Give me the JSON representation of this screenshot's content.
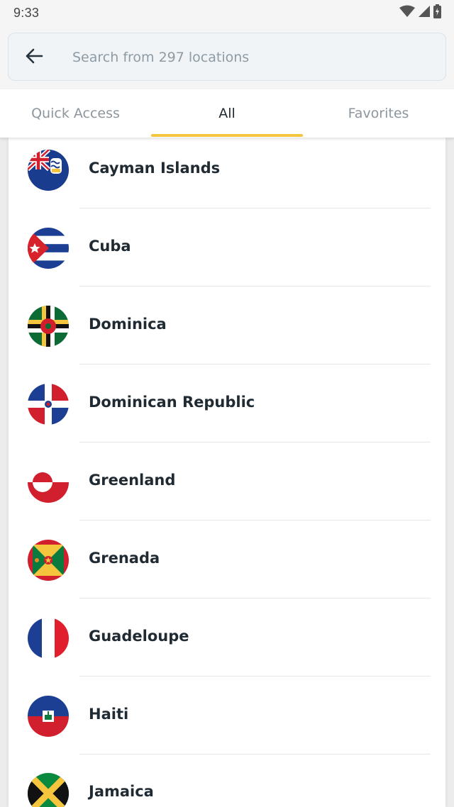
{
  "status_bar": {
    "time": "9:33",
    "icons": [
      "wifi-icon",
      "signal-icon",
      "battery-icon"
    ]
  },
  "search": {
    "back_icon": "arrow-left-icon",
    "placeholder": "Search from 297 locations",
    "value": ""
  },
  "tabs": [
    {
      "label": "Quick Access",
      "active": false
    },
    {
      "label": "All",
      "active": true
    },
    {
      "label": "Favorites",
      "active": false
    }
  ],
  "colors": {
    "accent": "#f4c53d",
    "text_primary": "#1f2a33",
    "text_muted": "#8c969e"
  },
  "locations": [
    {
      "name": "Cayman Islands",
      "flag": "cayman-islands-flag-icon"
    },
    {
      "name": "Cuba",
      "flag": "cuba-flag-icon"
    },
    {
      "name": "Dominica",
      "flag": "dominica-flag-icon"
    },
    {
      "name": "Dominican Republic",
      "flag": "dominican-republic-flag-icon"
    },
    {
      "name": "Greenland",
      "flag": "greenland-flag-icon"
    },
    {
      "name": "Grenada",
      "flag": "grenada-flag-icon"
    },
    {
      "name": "Guadeloupe",
      "flag": "guadeloupe-flag-icon"
    },
    {
      "name": "Haiti",
      "flag": "haiti-flag-icon"
    },
    {
      "name": "Jamaica",
      "flag": "jamaica-flag-icon"
    }
  ]
}
